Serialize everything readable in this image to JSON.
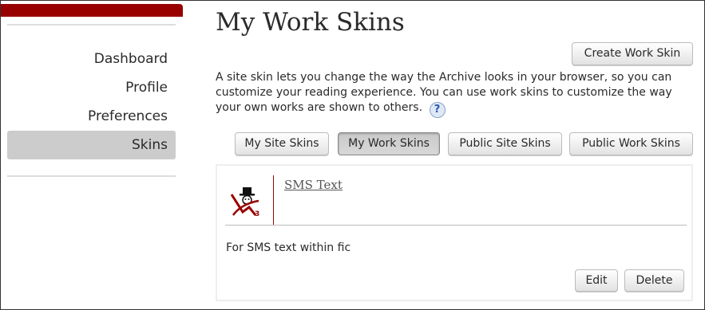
{
  "sidebar": {
    "items": [
      {
        "label": "Dashboard"
      },
      {
        "label": "Profile"
      },
      {
        "label": "Preferences"
      },
      {
        "label": "Skins",
        "active": true
      }
    ]
  },
  "main": {
    "title": "My Work Skins",
    "create_button": "Create Work Skin",
    "intro_text": "A site skin lets you change the way the Archive looks in your browser, so you can customize your reading experience. You can use work skins to customize the way your own works are shown to others.",
    "help_glyph": "?",
    "tabs": [
      {
        "label": "My Site Skins"
      },
      {
        "label": "My Work Skins",
        "selected": true
      },
      {
        "label": "Public Site Skins"
      },
      {
        "label": "Public Work Skins"
      }
    ],
    "skin": {
      "title": "SMS Text",
      "description": "For SMS text within fic",
      "icon": "ao3-skin-icon",
      "edit_button": "Edit",
      "delete_button": "Delete"
    }
  },
  "colors": {
    "brand_red": "#990000",
    "active_nav_bg": "#cccccc",
    "help_icon_blue": "#2a5aa8"
  }
}
